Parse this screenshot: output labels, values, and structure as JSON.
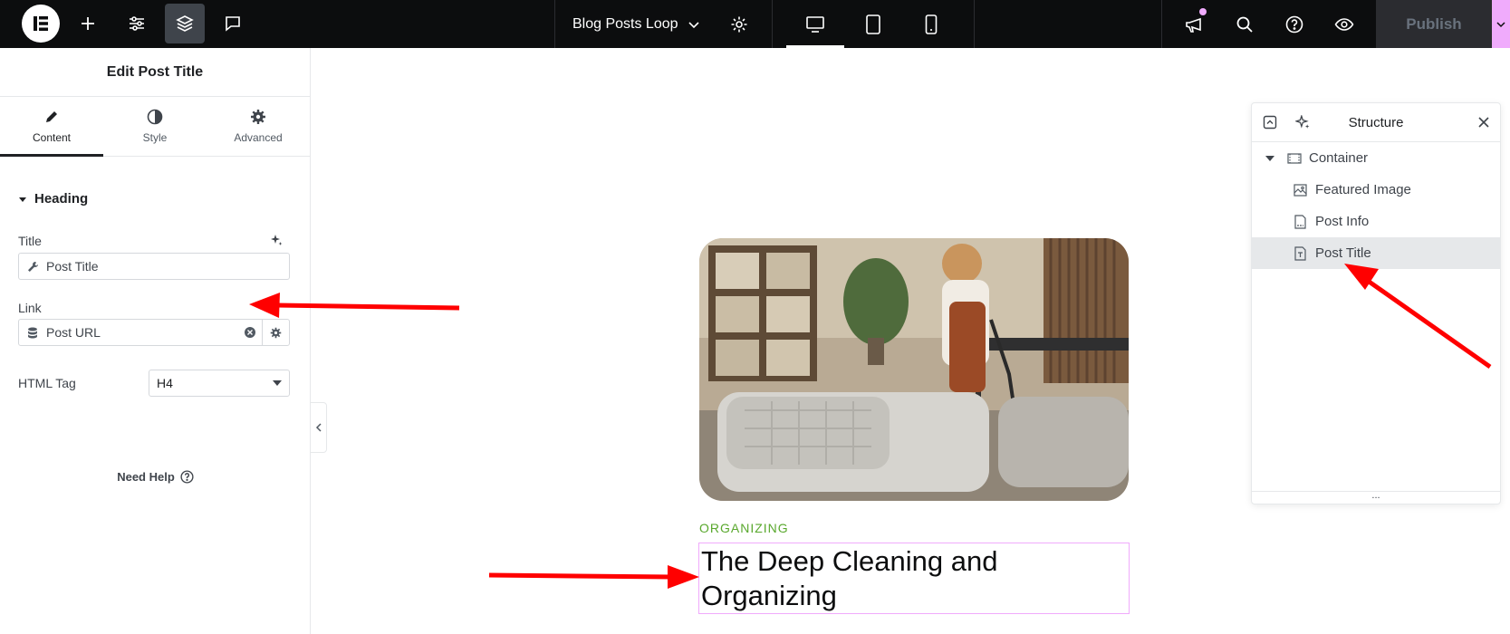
{
  "topbar": {
    "document_title": "Blog Posts Loop",
    "publish_label": "Publish"
  },
  "panel": {
    "header": "Edit Post Title",
    "tabs": [
      {
        "label": "Content",
        "icon": "pencil-icon"
      },
      {
        "label": "Style",
        "icon": "contrast-icon"
      },
      {
        "label": "Advanced",
        "icon": "gear-icon"
      }
    ],
    "section": "Heading",
    "title_label": "Title",
    "title_value": "Post Title",
    "link_label": "Link",
    "link_value": "Post URL",
    "html_tag_label": "HTML Tag",
    "html_tag_value": "H4",
    "need_help": "Need Help"
  },
  "canvas": {
    "category": "ORGANIZING",
    "post_title": "The Deep Cleaning and Organizing"
  },
  "structure": {
    "title": "Structure",
    "items": [
      {
        "label": "Container"
      },
      {
        "label": "Featured Image"
      },
      {
        "label": "Post Info"
      },
      {
        "label": "Post Title"
      }
    ],
    "footer": "..."
  },
  "colors": {
    "topbar_bg": "#0c0d0e",
    "accent_pink": "#f0abfc",
    "category_green": "#59a82d",
    "annotation_arrow": "#ff0000"
  }
}
